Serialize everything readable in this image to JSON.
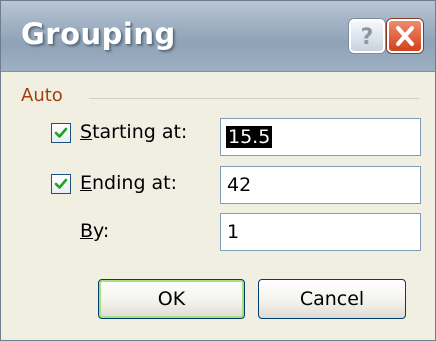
{
  "window": {
    "title": "Grouping",
    "help_label": "?",
    "close_label": "X"
  },
  "auto_group": {
    "label": "Auto",
    "starting": {
      "checked": true,
      "mnemonic": "S",
      "label_rest": "tarting at:",
      "value": "15.5",
      "selected": true
    },
    "ending": {
      "checked": true,
      "mnemonic": "E",
      "label_rest": "nding at:",
      "value": "42"
    },
    "by": {
      "mnemonic": "B",
      "label_rest": "y:",
      "value": "1"
    }
  },
  "buttons": {
    "ok_label": "OK",
    "cancel_label": "Cancel"
  }
}
